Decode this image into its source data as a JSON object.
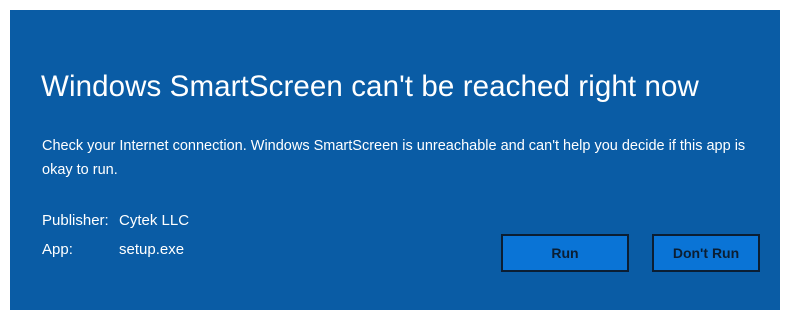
{
  "dialog": {
    "title": "Windows SmartScreen can't be reached right now",
    "message": "Check your Internet connection. Windows SmartScreen is unreachable and can't help you decide if this app is okay to run.",
    "background_color": "#0a5ca5",
    "details": [
      {
        "label": "Publisher:",
        "value": "Cytek LLC"
      },
      {
        "label": "App:",
        "value": "setup.exe"
      }
    ],
    "buttons": {
      "run_label": "Run",
      "dont_run_label": "Don't Run"
    }
  }
}
